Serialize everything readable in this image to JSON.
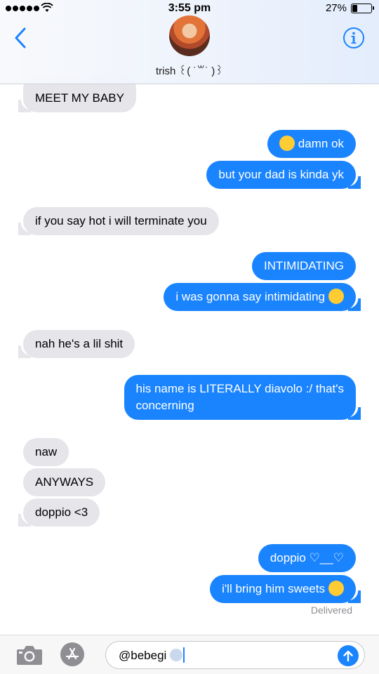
{
  "status_bar": {
    "time": "3:55 pm",
    "battery": "27%",
    "battery_level": 0.27
  },
  "header": {
    "contact_name": "trish ꒰( ˙꒳˙ )꒱",
    "back_icon": "chevron-left-icon",
    "info_icon": "info-icon"
  },
  "messages": [
    {
      "side": "in",
      "text": "MEET MY BABY"
    },
    {
      "side": "out",
      "text": "damn ok",
      "emoji": "flushed-face"
    },
    {
      "side": "out",
      "text": "but your dad is kinda yk"
    },
    {
      "side": "in",
      "text": "if you say hot i will terminate you"
    },
    {
      "side": "out",
      "text": "INTIMIDATING"
    },
    {
      "side": "out",
      "text": "i was gonna say intimidating",
      "emoji": "loudly-crying-face"
    },
    {
      "side": "in",
      "text": "nah he's a lil shit"
    },
    {
      "side": "out",
      "line1": "his name is LITERALLY diavolo :/ that's",
      "line2": "concerning"
    },
    {
      "side": "in",
      "text": "naw"
    },
    {
      "side": "in",
      "text": "ANYWAYS"
    },
    {
      "side": "in",
      "text": "doppio <3"
    },
    {
      "side": "out",
      "text": "doppio ♡__♡"
    },
    {
      "side": "out",
      "text": "i'll bring him sweets",
      "emoji": "pleading-face"
    }
  ],
  "delivered_label": "Delivered",
  "composer": {
    "value": "@bebegi",
    "emoji": "dash-symbol",
    "camera_icon": "camera-icon",
    "appstore_icon": "app-store-icon",
    "send_icon": "send-arrow-icon"
  },
  "colors": {
    "outgoing": "#1a84ff",
    "incoming": "#e5e5ea"
  }
}
